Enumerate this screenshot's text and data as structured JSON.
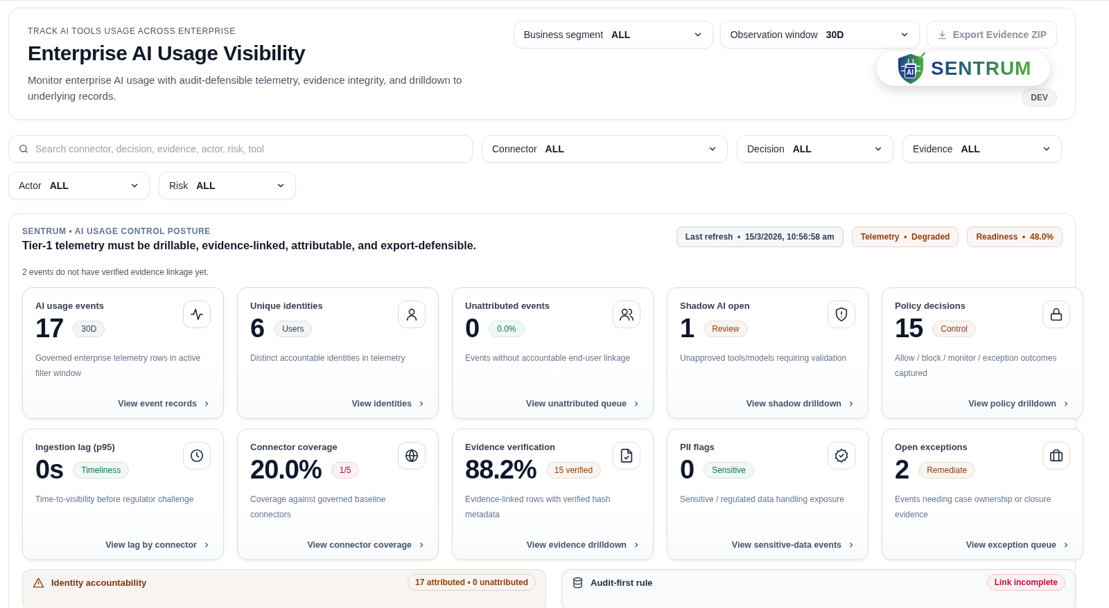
{
  "header": {
    "eyebrow": "TRACK AI TOOLS USAGE ACROSS ENTERPRISE",
    "title": "Enterprise AI Usage Visibility",
    "description": "Monitor enterprise AI usage with audit-defensible telemetry, evidence integrity, and drilldown to underlying records.",
    "selects": [
      {
        "label": "Business segment",
        "value": "ALL"
      },
      {
        "label": "Observation window",
        "value": "30D"
      }
    ],
    "export_button": {
      "label": "Export Evidence ZIP",
      "disabled": true
    },
    "environment": "DEV",
    "logo": {
      "wordmark": "SENTRUM",
      "mark": "AI"
    }
  },
  "filters": {
    "search": {
      "placeholder": "Search connector, decision, evidence, actor, risk, tool"
    },
    "selects": [
      {
        "label": "Connector",
        "value": "ALL"
      },
      {
        "label": "Decision",
        "value": "ALL"
      },
      {
        "label": "Evidence",
        "value": "ALL"
      },
      {
        "label": "Actor",
        "value": "ALL"
      },
      {
        "label": "Risk",
        "value": "ALL"
      }
    ]
  },
  "posture": {
    "eyebrow": "SENTRUM • AI USAGE CONTROL POSTURE",
    "title": "Tier-1 telemetry must be drillable, evidence-linked, attributable, and export-defensible.",
    "note": "2 events do not have verified evidence linkage yet.",
    "pills": [
      {
        "text": "Last refresh  •  15/3/2026, 10:56:58 am",
        "color": "#334155"
      },
      {
        "text": "Telemetry  •  Degraded",
        "color": "#92400e"
      },
      {
        "text": "Readiness  •  48.0%",
        "color": "#92400e"
      }
    ],
    "cards": [
      {
        "title": "AI usage events",
        "value": "17",
        "badge": "30D",
        "description": "Governed enterprise telemetry rows in active filter window",
        "link": "View event records",
        "kind": "pulse",
        "color": "#334155"
      },
      {
        "title": "Unique identities",
        "value": "6",
        "badge": "Users",
        "description": "Distinct accountable identities in telemetry",
        "link": "View identities",
        "kind": "user",
        "color": "#334155"
      },
      {
        "title": "Unattributed events",
        "value": "0",
        "badge": "0.0%",
        "description": "Events without accountable end-user linkage",
        "link": "View unattributed queue",
        "kind": "users",
        "color": "#047857"
      },
      {
        "title": "Shadow AI open",
        "value": "1",
        "badge": "Review",
        "description": "Unapproved tools/models requiring validation",
        "link": "View shadow drilldown",
        "kind": "shield",
        "color": "#92400e"
      },
      {
        "title": "Policy decisions",
        "value": "15",
        "badge": "Control",
        "description": "Allow / block / monitor / exception outcomes captured",
        "link": "View policy drilldown",
        "kind": "lock",
        "color": "#92400e"
      },
      {
        "title": "Ingestion lag (p95)",
        "value": "0s",
        "badge": "Timeliness",
        "description": "Time-to-visibility before regulator challenge",
        "link": "View lag by connector",
        "kind": "clock",
        "color": "#047857"
      },
      {
        "title": "Connector coverage",
        "value": "20.0%",
        "badge": "1/5",
        "description": "Coverage against governed baseline connectors",
        "link": "View connector coverage",
        "kind": "globe",
        "color": "#9f1239"
      },
      {
        "title": "Evidence verification",
        "value": "88.2%",
        "badge": "15 verified",
        "description": "Evidence-linked rows with verified hash metadata",
        "link": "View evidence drilldown",
        "kind": "file",
        "color": "#92400e"
      },
      {
        "title": "PII flags",
        "value": "0",
        "badge": "Sensitive",
        "description": "Sensitive / regulated data handling exposure",
        "link": "View sensitive-data events",
        "kind": "badge",
        "color": "#047857"
      },
      {
        "title": "Open exceptions",
        "value": "2",
        "badge": "Remediate",
        "description": "Events needing case ownership or closure evidence",
        "link": "View exception queue",
        "kind": "briefcase",
        "color": "#92400e"
      }
    ],
    "panels": [
      {
        "title": "Identity accountability",
        "pill": "17 attributed • 0 unattributed",
        "kind": "warning",
        "color": "#92400e"
      },
      {
        "title": "Audit-first rule",
        "pill": "Link incomplete",
        "kind": "database",
        "color": "#be123c"
      }
    ]
  }
}
